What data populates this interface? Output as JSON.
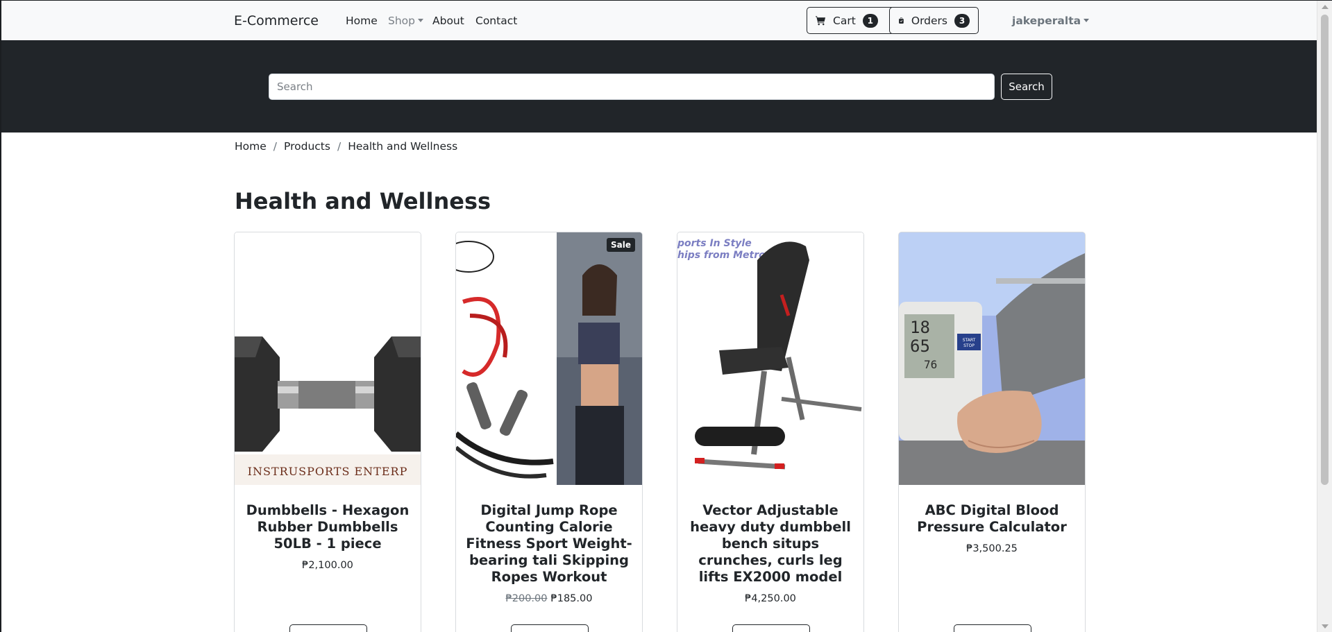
{
  "navbar": {
    "brand": "E-Commerce",
    "links": [
      "Home",
      "Shop",
      "About",
      "Contact"
    ],
    "cart_label": "Cart",
    "cart_count": "1",
    "orders_label": "Orders",
    "orders_count": "3",
    "user": "jakeperalta"
  },
  "search": {
    "placeholder": "Search",
    "button": "Search"
  },
  "breadcrumb": [
    "Home",
    "Products",
    "Health and Wellness"
  ],
  "page_title": "Health and Wellness",
  "products": [
    {
      "name": "Dumbbells - Hexagon Rubber Dumbbells 50LB - 1 piece",
      "price": "₱2,100.00",
      "image_text": "INSTRUSPORTS ENTERP"
    },
    {
      "name": "Digital Jump Rope Counting Calorie Fitness Sport Weight-bearing tali Skipping Ropes Workout",
      "old_price": "₱200.00",
      "price": "₱185.00",
      "badge": "Sale"
    },
    {
      "name": "Vector Adjustable heavy duty dumbbell bench situps crunches, curls leg lifts EX2000 model",
      "price": "₱4,250.00",
      "image_text": [
        "ports In Style",
        "hips from Metro Manila"
      ]
    },
    {
      "name": "ABC Digital Blood Pressure Calculator",
      "price": "₱3,500.25",
      "image_text": [
        "18",
        "65",
        "76",
        "START",
        "STOP"
      ]
    }
  ],
  "colors": {
    "dark": "#212529",
    "light": "#f8f9fa",
    "muted": "#6c757d"
  }
}
